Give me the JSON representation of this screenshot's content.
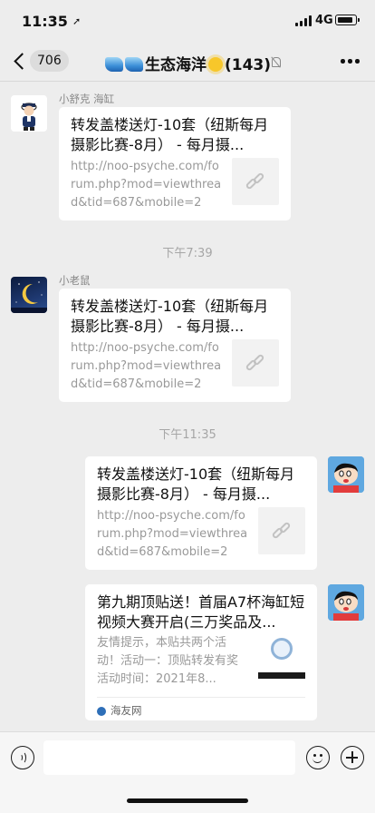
{
  "status_bar": {
    "time": "11:35",
    "network": "4G"
  },
  "nav": {
    "unread_count": "706",
    "title": "生态海洋",
    "member_count": "(143)"
  },
  "messages": [
    {
      "sender": "小舒克 海缸",
      "title": "转发盖楼送灯-10套（纽斯每月摄影比赛-8月） - 每月摄...",
      "desc": "http://noo-psyche.com/forum.php?mod=viewthread&tid=687&mobile=2"
    },
    {
      "sender": "小老鼠",
      "title": "转发盖楼送灯-10套（纽斯每月摄影比赛-8月） - 每月摄...",
      "desc": "http://noo-psyche.com/forum.php?mod=viewthread&tid=687&mobile=2"
    },
    {
      "sender": "",
      "title": "转发盖楼送灯-10套（纽斯每月摄影比赛-8月） - 每月摄...",
      "desc": "http://noo-psyche.com/forum.php?mod=viewthread&tid=687&mobile=2"
    },
    {
      "sender": "",
      "title": "第九期顶贴送！首届A7杯海缸短视频大赛开启(三万奖品及...",
      "desc": "友情提示，本贴共两个活动！活动一：顶贴转发有奖活动时间：2021年8...",
      "source": "海友网"
    }
  ],
  "timestamps": [
    "下午7:39",
    "下午11:35"
  ]
}
